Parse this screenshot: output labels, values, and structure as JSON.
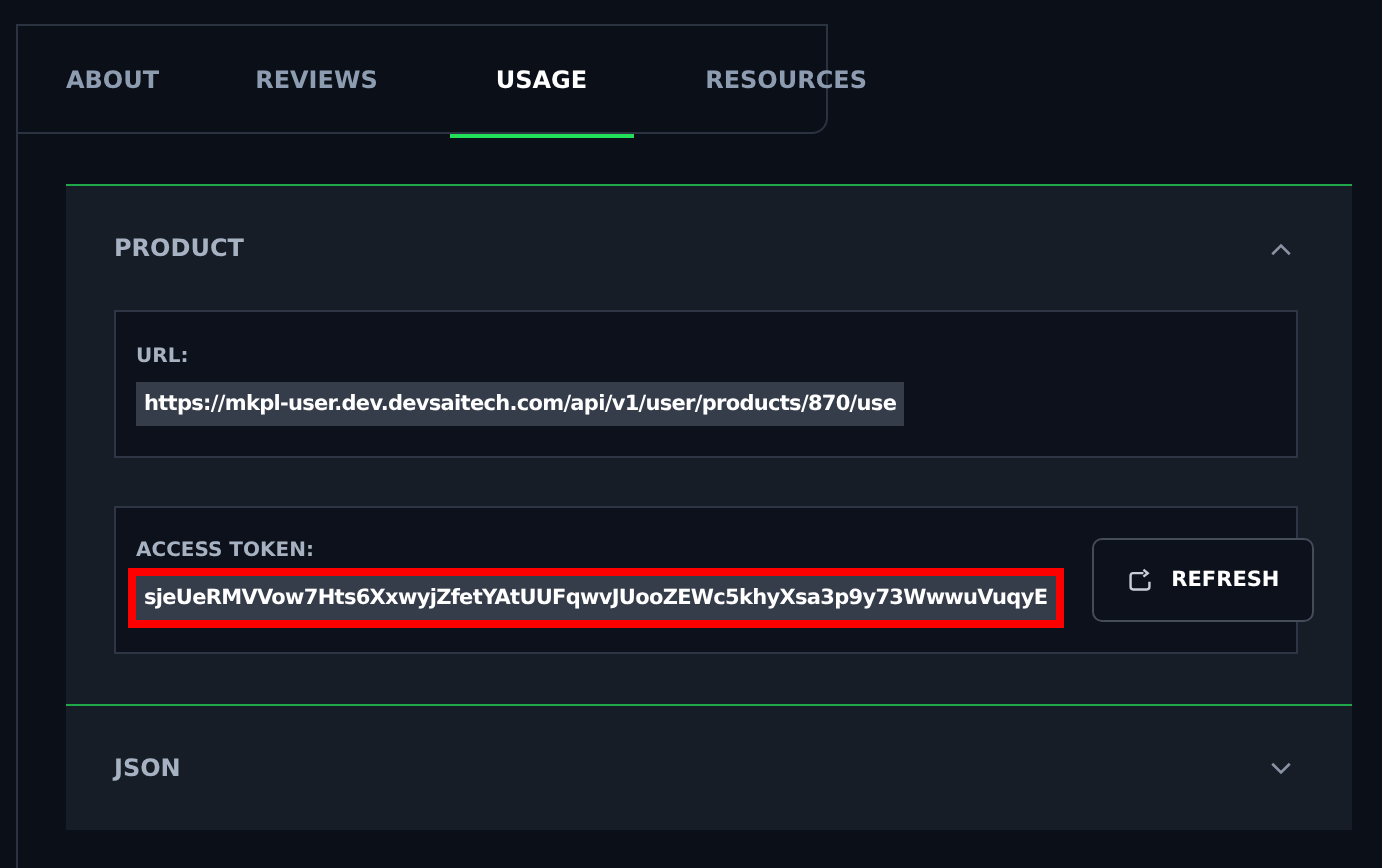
{
  "tabs": [
    {
      "label": "ABOUT",
      "selected": false
    },
    {
      "label": "REVIEWS",
      "selected": false
    },
    {
      "label": "USAGE",
      "selected": true
    },
    {
      "label": "RESOURCES",
      "selected": false
    }
  ],
  "sections": [
    {
      "title": "PRODUCT",
      "expanded": true,
      "fields": [
        {
          "label": "URL:",
          "value": "https://mkpl-user.dev.devsaitech.com/api/v1/user/products/870/use",
          "highlighted": false
        },
        {
          "label": "ACCESS TOKEN:",
          "value": "sjeUeRMVVow7Hts6XxwyjZfetYAtUUFqwvJUooZEWc5khyXsa3p9y73WwwuVuqyE",
          "highlighted": true,
          "button": "REFRESH"
        }
      ]
    },
    {
      "title": "JSON",
      "expanded": false
    }
  ]
}
